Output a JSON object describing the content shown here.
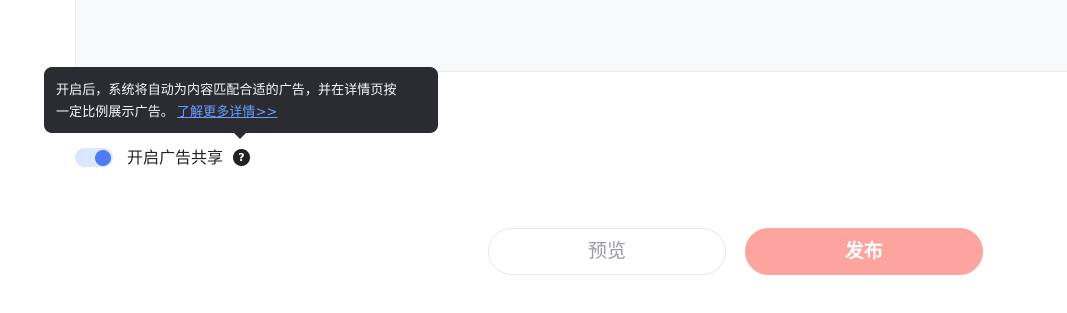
{
  "tooltip": {
    "line1": "开启后，系统将自动为内容匹配合适的广告，并在详情页按",
    "line2": "一定比例展示广告。",
    "link": "了解更多详情>>"
  },
  "ad_share": {
    "label": "开启广告共享",
    "enabled": true,
    "help_icon": "?"
  },
  "actions": {
    "preview_label": "预览",
    "publish_label": "发布"
  },
  "colors": {
    "accent": "#4e7cf6",
    "publish_button": "#fea49f",
    "tooltip_bg": "#2a2c31",
    "link": "#6c9cff"
  }
}
